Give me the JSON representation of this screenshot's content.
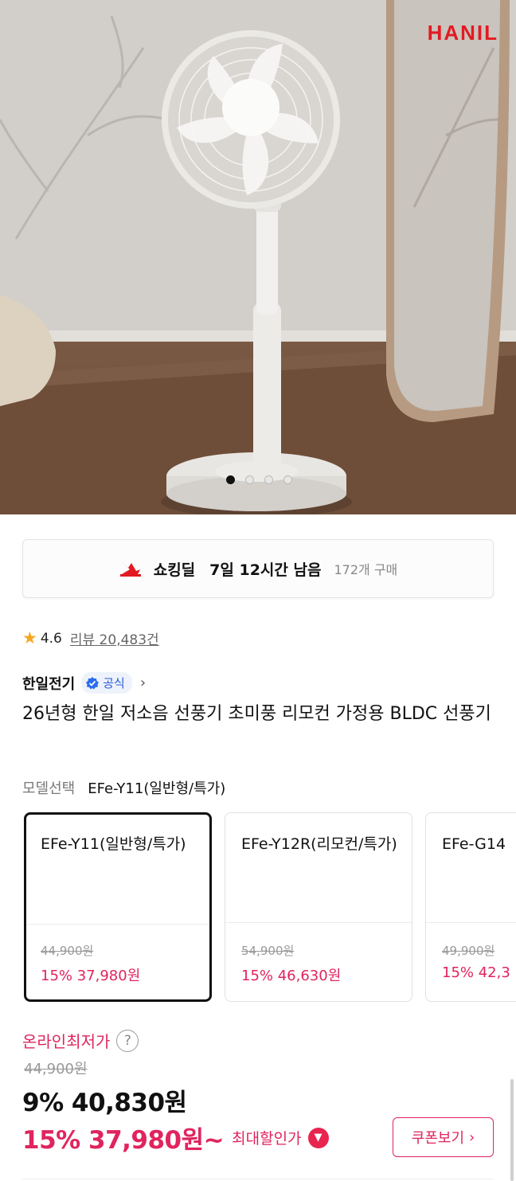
{
  "hero": {
    "brand_logo": "HANIL",
    "carousel_total": 4,
    "carousel_active": 1
  },
  "deal": {
    "title": "쇼킹딜",
    "time_left": "7일 12시간 남음",
    "purchases": "172개 구매"
  },
  "rating": {
    "score": "4.6",
    "reviews": "리뷰 20,483건"
  },
  "seller": {
    "name": "한일전기",
    "badge": "공식"
  },
  "product": {
    "title": "26년형 한일 저소음 선풍기 초미풍 리모컨 가정용 BLDC 선풍기"
  },
  "model_select": {
    "label": "모델선택",
    "selected": "EFe-Y11(일반형/특가)",
    "options": [
      {
        "name": "EFe-Y11(일반형/특가)",
        "original_price": "44,900원",
        "sale": "15% 37,980원"
      },
      {
        "name": "EFe-Y12R(리모컨/특가)",
        "original_price": "54,900원",
        "sale": "15% 46,630원"
      },
      {
        "name": "EFe-G14",
        "original_price": "49,900원",
        "sale": "15% 42,3"
      }
    ]
  },
  "pricing": {
    "lowest_label": "온라인최저가",
    "help": "?",
    "original": "44,900원",
    "discount_price": "9% 40,830원",
    "best_price": "15% 37,980원~",
    "best_label": "최대할인가",
    "coupon_button": "쿠폰보기",
    "coupon_chevron": "›"
  },
  "colors": {
    "accent": "#e0245e",
    "brand_red": "#e21a22",
    "official_blue": "#2a5bd7",
    "star": "#f5a623"
  },
  "icons": [
    "check-badge-icon",
    "chevron-right-icon",
    "star-icon",
    "help-icon",
    "chevron-down-icon",
    "shocking-deal-icon"
  ]
}
